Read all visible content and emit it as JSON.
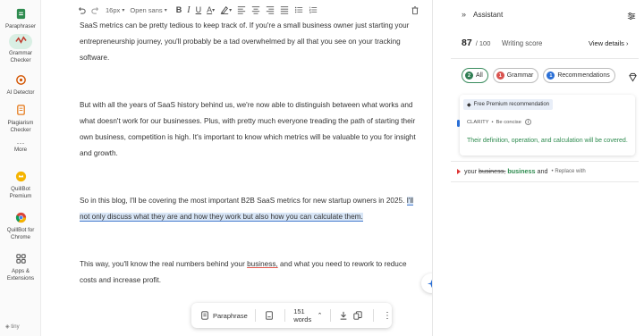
{
  "sidebar": {
    "items": [
      {
        "label": "Paraphraser",
        "icon": "paraphraser-icon"
      },
      {
        "label": "Grammar Checker",
        "icon": "grammar-checker-icon",
        "active": true
      },
      {
        "label": "AI Detector",
        "icon": "ai-detector-icon"
      },
      {
        "label": "Plagiarism Checker",
        "icon": "plagiarism-checker-icon"
      },
      {
        "label": "More",
        "icon": "more-icon"
      },
      {
        "label": "QuillBot Premium",
        "icon": "premium-icon"
      },
      {
        "label": "QuillBot for Chrome",
        "icon": "chrome-icon"
      },
      {
        "label": "Apps & Extensions",
        "icon": "apps-icon"
      }
    ],
    "footer": "tiny"
  },
  "toolbar": {
    "font_size": "16px",
    "font_family": "Open sans"
  },
  "document": {
    "p1": "SaaS metrics can be pretty tedious to keep track of. If you're a small business owner just starting your entrepreneurship journey, you'll probably be a tad overwhelmed by all that you see on your tracking software.",
    "p2": "But with all the years of SaaS history behind us, we're now able to distinguish between what works and what doesn't work for our businesses. Plus, with pretty much everyone treading the path of starting their own business, competition is high. It's important to know which metrics will be valuable to you for insight and growth.",
    "p3_a": "So in this blog, I'll be covering the most important B2B SaaS metrics for new startup owners in 2025. ",
    "p3_highlight": "I'll not only discuss what they are and how they work but also how you can calculate them.",
    "p4_a": "This way, you'll know the real numbers behind your ",
    "p4_err": "business,",
    "p4_b": " and what you need to rework to reduce costs and increase profit."
  },
  "floating_toolbar": {
    "paraphrase": "Paraphrase",
    "word_count": "151 words"
  },
  "assistant": {
    "title": "Assistant",
    "score": "87",
    "score_max": "/ 100",
    "score_label": "Writing score",
    "view_details": "View details",
    "tabs": [
      {
        "label": "All",
        "count": "2",
        "color": "#2e7d52"
      },
      {
        "label": "Grammar",
        "count": "1",
        "color": "#d9534f"
      },
      {
        "label": "Recommendations",
        "count": "1",
        "color": "#2a6fd6"
      }
    ],
    "card": {
      "badge": "Free Premium recommendation",
      "category": "CLARITY",
      "subcategory": "Be concise",
      "suggestion": "Their definition, operation, and calculation will be covered."
    },
    "fix": {
      "before": "your",
      "strike": "business,",
      "replacement": "business",
      "after": "and",
      "action": "Replace with"
    }
  }
}
